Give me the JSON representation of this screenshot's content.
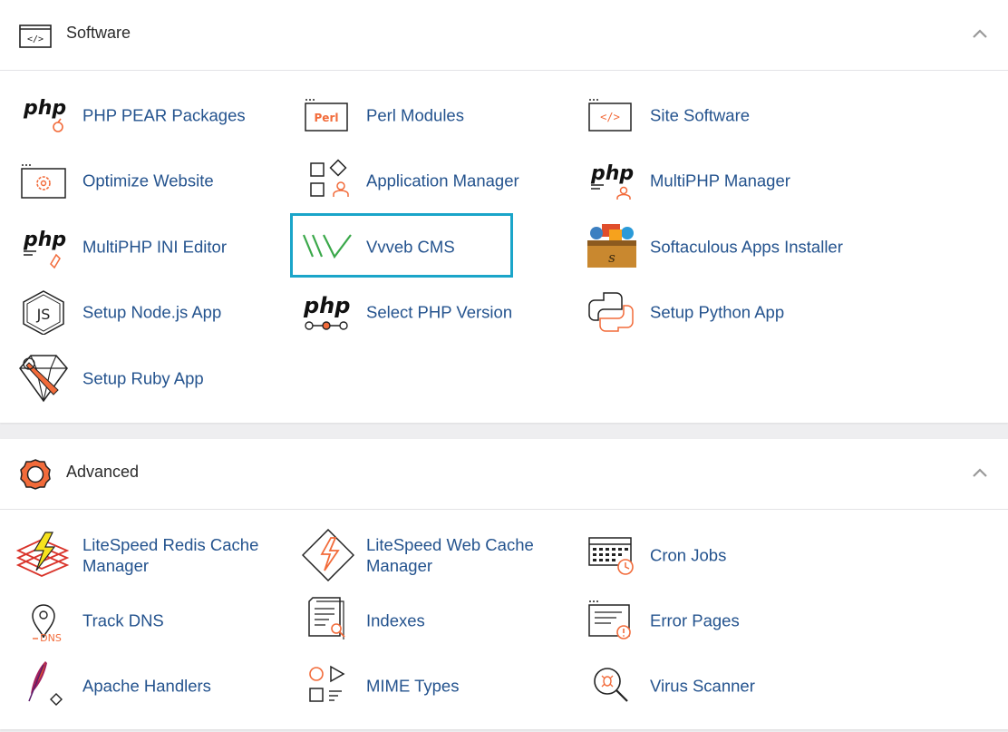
{
  "software": {
    "title": "Software",
    "items": [
      {
        "label": "PHP PEAR Packages",
        "icon": "php-pear-icon"
      },
      {
        "label": "Perl Modules",
        "icon": "perl-icon"
      },
      {
        "label": "Site Software",
        "icon": "code-window-icon"
      },
      {
        "label": "Optimize Website",
        "icon": "gear-window-icon"
      },
      {
        "label": "Application Manager",
        "icon": "app-grid-icon"
      },
      {
        "label": "MultiPHP Manager",
        "icon": "multiphp-icon"
      },
      {
        "label": "MultiPHP INI Editor",
        "icon": "php-ini-icon"
      },
      {
        "label": "Vvveb CMS",
        "icon": "vvveb-icon"
      },
      {
        "label": "Softaculous Apps Installer",
        "icon": "softaculous-icon"
      },
      {
        "label": "Setup Node.js App",
        "icon": "nodejs-icon"
      },
      {
        "label": "Select PHP Version",
        "icon": "php-version-icon"
      },
      {
        "label": "Setup Python App",
        "icon": "python-icon"
      },
      {
        "label": "Setup Ruby App",
        "icon": "ruby-icon"
      }
    ]
  },
  "advanced": {
    "title": "Advanced",
    "items": [
      {
        "label": "LiteSpeed Redis Cache Manager",
        "icon": "redis-icon"
      },
      {
        "label": "LiteSpeed Web Cache Manager",
        "icon": "litespeed-icon"
      },
      {
        "label": "Cron Jobs",
        "icon": "calendar-clock-icon"
      },
      {
        "label": "Track DNS",
        "icon": "dns-pin-icon"
      },
      {
        "label": "Indexes",
        "icon": "document-search-icon"
      },
      {
        "label": "Error Pages",
        "icon": "error-page-icon"
      },
      {
        "label": "Apache Handlers",
        "icon": "feather-icon"
      },
      {
        "label": "MIME Types",
        "icon": "shapes-icon"
      },
      {
        "label": "Virus Scanner",
        "icon": "virus-search-icon"
      }
    ]
  },
  "colors": {
    "link": "#24538e",
    "accent": "#f26b3a",
    "highlight": "#1aa5c9",
    "vvveb_green": "#3aa84a"
  }
}
